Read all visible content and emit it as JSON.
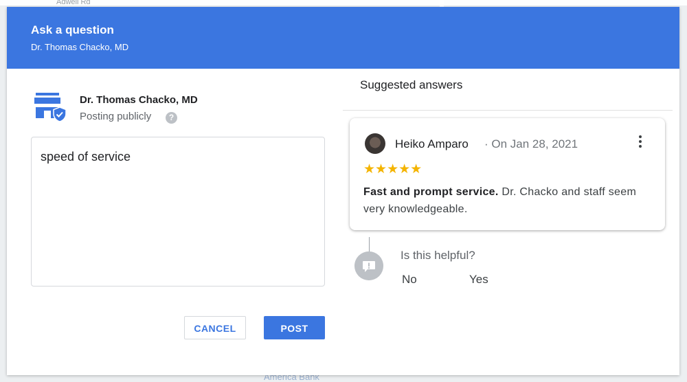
{
  "dialog": {
    "title": "Ask a question",
    "subtitle": "Dr. Thomas Chacko, MD"
  },
  "poster": {
    "name": "Dr. Thomas Chacko, MD",
    "visibility": "Posting publicly",
    "help_glyph": "?",
    "icon": "storefront-verified-icon"
  },
  "question": {
    "value": "speed of service"
  },
  "buttons": {
    "cancel": "CANCEL",
    "post": "POST"
  },
  "suggestions": {
    "title": "Suggested answers",
    "answers": [
      {
        "reviewer": "Heiko Amparo",
        "date": "· On Jan 28, 2021",
        "stars": "★★★★★",
        "rating": 5,
        "highlight": "Fast and prompt service.",
        "text": " Dr. Chacko and staff seem very knowledgeable."
      }
    ]
  },
  "helpful": {
    "question": "Is this helpful?",
    "no": "No",
    "yes": "Yes"
  },
  "map": {
    "street_label": "Adwell Rd",
    "bank_label": "America Bank"
  },
  "colors": {
    "brand_blue": "#3b76e0",
    "star": "#f4b400"
  }
}
